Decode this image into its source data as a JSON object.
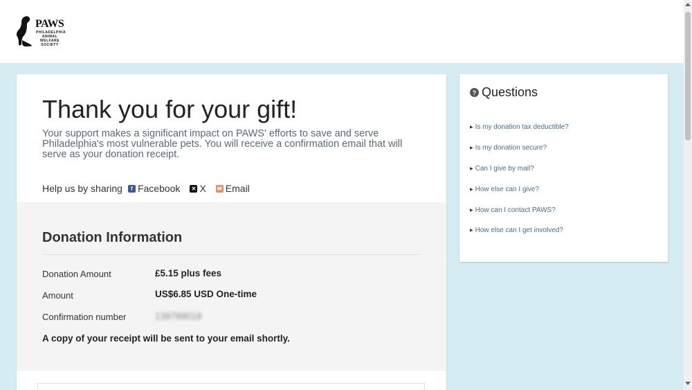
{
  "header": {
    "logo": {
      "title": "PAWS",
      "subtitle": "PHILADELPHIA ANIMAL WELFARE SOCIETY"
    }
  },
  "thanks": {
    "title": "Thank you for your gift!",
    "message": "Your support makes a significant impact on PAWS' efforts to save and serve Philadelphia's most vulnerable pets. You will receive a confirmation email that will serve as your donation receipt."
  },
  "share": {
    "label": "Help us by sharing",
    "facebook": "Facebook",
    "x": "X",
    "email": "Email"
  },
  "donation": {
    "title": "Donation Information",
    "rows": [
      {
        "label": "Donation Amount",
        "value": "£5.15 plus fees"
      },
      {
        "label": "Amount",
        "value": "US$6.85 USD One-time"
      },
      {
        "label": "Confirmation number",
        "value": "138788018"
      }
    ],
    "receipt_note": "A copy of your receipt will be sent to your email shortly."
  },
  "faq": {
    "title": "Questions",
    "items": [
      {
        "label": "Is my donation tax deductible?"
      },
      {
        "label": "Is my donation secure?"
      },
      {
        "label": "Can I give by mail?"
      },
      {
        "label": "How else can I give?"
      },
      {
        "label": "How can I contact PAWS?"
      },
      {
        "label": "How else can I get involved?"
      }
    ]
  },
  "colors": {
    "page_background": "#d6ecf3",
    "link": "#4a6a8a",
    "facebook": "#3b5998",
    "email": "#e98a6a"
  },
  "icons": {
    "facebook": "facebook-icon",
    "x": "x-icon",
    "email": "email-icon",
    "question": "question-circle-icon",
    "caret": "caret-right-icon"
  }
}
